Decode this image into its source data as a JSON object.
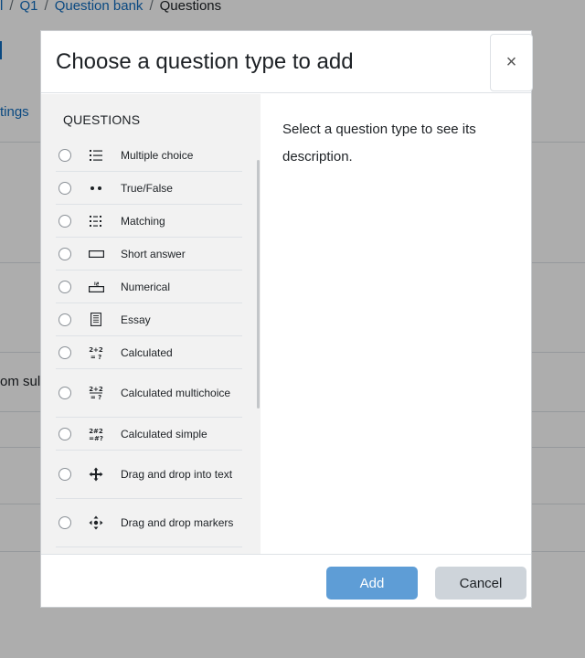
{
  "breadcrumb": {
    "items": [
      {
        "label": "l"
      },
      {
        "label": "Q1"
      },
      {
        "label": "Question bank"
      },
      {
        "label": "Questions"
      }
    ],
    "separator": "/"
  },
  "background": {
    "settings_link": "tings",
    "from_text": "om sul"
  },
  "modal": {
    "title": "Choose a question type to add",
    "close_label": "×",
    "section_label": "QUESTIONS",
    "question_types": [
      {
        "label": "Multiple choice",
        "icon": "list-icon"
      },
      {
        "label": "True/False",
        "icon": "two-dots-icon"
      },
      {
        "label": "Matching",
        "icon": "matching-icon"
      },
      {
        "label": "Short answer",
        "icon": "text-box-icon"
      },
      {
        "label": "Numerical",
        "icon": "numeric-field-icon"
      },
      {
        "label": "Essay",
        "icon": "document-icon"
      },
      {
        "label": "Calculated",
        "icon": "formula-icon"
      },
      {
        "label": "Calculated multichoice",
        "icon": "formula-list-icon"
      },
      {
        "label": "Calculated simple",
        "icon": "formula-simple-icon"
      },
      {
        "label": "Drag and drop into text",
        "icon": "move-arrows-icon"
      },
      {
        "label": "Drag and drop markers",
        "icon": "move-markers-icon"
      }
    ],
    "description": "Select a question type to see its description.",
    "add_label": "Add",
    "cancel_label": "Cancel"
  },
  "colors": {
    "link": "#0f6cbf",
    "primary_button": "#5e9dd6",
    "secondary_button": "#ced4da",
    "option_pane": "#f2f2f2"
  }
}
